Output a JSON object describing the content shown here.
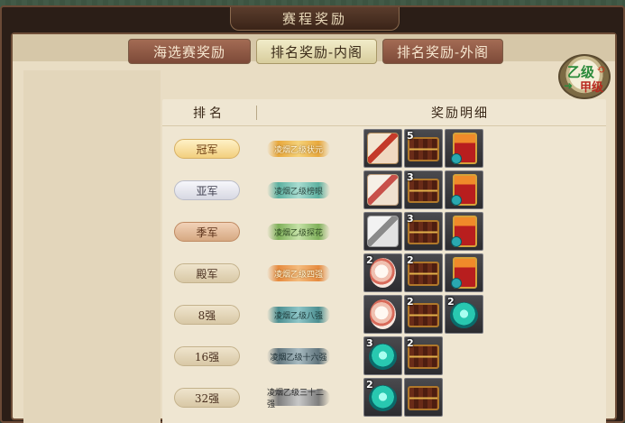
{
  "window": {
    "title": "赛程奖励"
  },
  "tabs": [
    {
      "label": "海选赛奖励",
      "active": false
    },
    {
      "label": "排名奖励-内阁",
      "active": true
    },
    {
      "label": "排名奖励-外阁",
      "active": false
    }
  ],
  "grade_toggle": {
    "top": "乙级",
    "bottom": "甲级"
  },
  "table": {
    "headers": {
      "rank": "排名",
      "reward": "奖励明细"
    },
    "rows": [
      {
        "rank": "冠军",
        "tier": "gold",
        "title": "凌烟乙级状元",
        "title_style": "t-gold",
        "items": [
          {
            "icon": "lacquer-box-icon",
            "count": ""
          },
          {
            "icon": "treasure-chest-icon",
            "count": "5"
          },
          {
            "icon": "gift-box-icon",
            "count": ""
          }
        ]
      },
      {
        "rank": "亚军",
        "tier": "silver",
        "title": "凌烟乙级榜眼",
        "title_style": "t-cyan",
        "items": [
          {
            "icon": "lacquer-box-icon",
            "count": ""
          },
          {
            "icon": "treasure-chest-icon",
            "count": "3"
          },
          {
            "icon": "gift-box-icon",
            "count": ""
          }
        ]
      },
      {
        "rank": "季军",
        "tier": "bronze",
        "title": "凌烟乙级探花",
        "title_style": "t-green",
        "items": [
          {
            "icon": "white-box-icon",
            "count": ""
          },
          {
            "icon": "treasure-chest-icon",
            "count": "3"
          },
          {
            "icon": "gift-box-icon",
            "count": ""
          }
        ]
      },
      {
        "rank": "殿军",
        "tier": "plain",
        "title": "凌烟乙级四强",
        "title_style": "t-orange",
        "items": [
          {
            "icon": "lantern-icon",
            "count": "2"
          },
          {
            "icon": "treasure-chest-icon",
            "count": "2"
          },
          {
            "icon": "gift-box-icon",
            "count": ""
          }
        ]
      },
      {
        "rank": "8强",
        "tier": "plain",
        "title": "凌烟乙级八强",
        "title_style": "t-teal",
        "items": [
          {
            "icon": "lantern-icon",
            "count": ""
          },
          {
            "icon": "treasure-chest-icon",
            "count": "2"
          },
          {
            "icon": "jade-disc-icon",
            "count": "2"
          }
        ]
      },
      {
        "rank": "16强",
        "tier": "plain",
        "title": "凌烟乙级十六强",
        "title_style": "t-dark",
        "items": [
          {
            "icon": "jade-disc-icon",
            "count": "3"
          },
          {
            "icon": "treasure-chest-icon",
            "count": "2"
          }
        ]
      },
      {
        "rank": "32强",
        "tier": "plain",
        "title": "凌烟乙级三十二强",
        "title_style": "t-grey",
        "items": [
          {
            "icon": "jade-disc-icon",
            "count": "2"
          },
          {
            "icon": "treasure-chest-icon",
            "count": ""
          }
        ]
      }
    ]
  }
}
